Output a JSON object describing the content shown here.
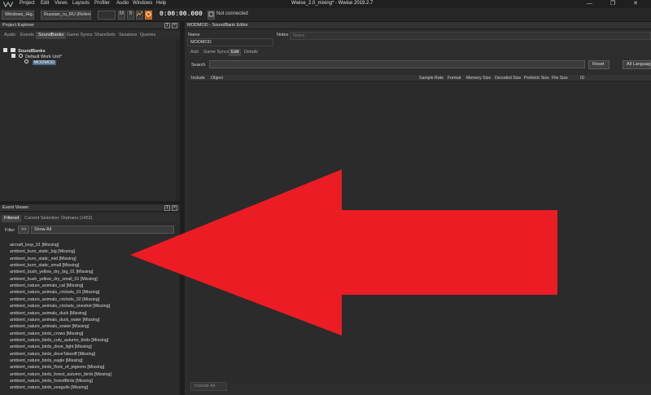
{
  "menubar": {
    "items": [
      "Project",
      "Edit",
      "Views",
      "Layouts",
      "Profiler",
      "Audio",
      "Windows",
      "Help"
    ],
    "title": "Wwise_2.0_mixing* - Wwise 2019.2.7",
    "controls": "—  ❐  ✕"
  },
  "toolbar": {
    "platform": "Windows_Hig...",
    "language": "Russian_ru_RU (Refere...",
    "btn_m": "M",
    "btn_s": "S",
    "time": "0:00:00.000",
    "status": "Not connected"
  },
  "project_explorer": {
    "title": "Project Explorer",
    "tabs": [
      "Audio",
      "Events",
      "SoundBanks",
      "Game Syncs",
      "ShareSets",
      "Sessions",
      "Queries"
    ],
    "active_tab": 2,
    "tree": [
      "SoundBanks",
      "Default Work Unit*",
      "MODMOD"
    ]
  },
  "event_viewer": {
    "title": "Event Viewer",
    "tabs": [
      "Filtered",
      "Current Selection",
      "Orphans (1452)"
    ],
    "filter_label": "Filter",
    "filter_btn": ">>",
    "filter_value": "Show All",
    "items": [
      "aircraft_loop_01 [Missing]",
      "ambient_burn_static_big [Missing]",
      "ambient_burn_static_mid [Missing]",
      "ambient_burn_static_small [Missing]",
      "ambient_bush_yellow_dry_big_01 [Missing]",
      "ambient_bush_yellow_dry_small_01 [Missing]",
      "ambient_nature_animals_cat [Missing]",
      "ambient_nature_animals_crickets_01 [Missing]",
      "ambient_nature_animals_crickets_02 [Missing]",
      "ambient_nature_animals_crickets_oneshot [Missing]",
      "ambient_nature_animals_duck [Missing]",
      "ambient_nature_animals_duck_water [Missing]",
      "ambient_nature_animals_snake [Missing]",
      "ambient_nature_birds_crows [Missing]",
      "ambient_nature_birds_cuty_autumn_birds [Missing]",
      "ambient_nature_birds_dove_light [Missing]",
      "ambient_nature_birds_doveTakeoff [Missing]",
      "ambient_nature_birds_eagle [Missing]",
      "ambient_nature_birds_flock_of_pigeons [Missing]",
      "ambient_nature_birds_forest_autumn_birds [Missing]",
      "ambient_nature_birds_forestBirds [Missing]",
      "ambient_nature_birds_seagulls [Missing]"
    ]
  },
  "soundbank_editor": {
    "title": "MODMOD - SoundBank Editor",
    "name_label": "Name",
    "name_value": "MODMOD",
    "notes_label": "Notes",
    "notes_placeholder": "Notes",
    "tabs": [
      "Add",
      "Game Syncs",
      "Edit",
      "Details"
    ],
    "active_tab": 2,
    "search_label": "Search",
    "reset_label": "Reset",
    "language": "All Languages",
    "columns": [
      "Include",
      "Object",
      "Sample Rate",
      "Format",
      "Memory Size",
      "Decoded Size",
      "Prefetch Size",
      "File Size",
      "ID"
    ],
    "include_all": "Include All"
  },
  "annotation": {
    "color": "#ec1c24"
  }
}
